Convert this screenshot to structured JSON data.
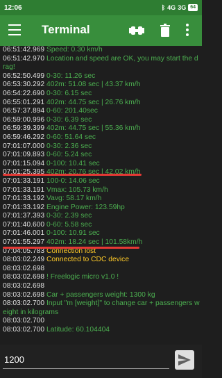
{
  "status": {
    "time": "12:06",
    "signal1": "4G",
    "signal2": "3G",
    "battery": "64"
  },
  "appbar": {
    "title": "Terminal"
  },
  "icons": {
    "menu": "menu-icon",
    "connect": "plug-connect-icon",
    "delete": "trash-icon",
    "more": "more-vert-icon",
    "send": "send-icon"
  },
  "colors": {
    "accent": "#388e3c",
    "status_bar": "#2e7d32",
    "terminal_bg": "#1e1e1e",
    "text_green": "#4caf50",
    "text_yellow": "#ffca28",
    "annotation": "#e53935"
  },
  "log": [
    {
      "ts": "06:51:42.969",
      "msg": "Speed: 0.30   km/h",
      "c": "g"
    },
    {
      "ts": "06:51:42.970",
      "msg": "Location and speed are OK, you may start the drag!",
      "c": "g"
    },
    {
      "ts": "06:52:50.499",
      "msg": "0-30: 11.26 sec",
      "c": "g"
    },
    {
      "ts": "06:53:30.292",
      "msg": "402m: 51.08 sec | 43.37 km/h",
      "c": "g"
    },
    {
      "ts": "06:54:22.690",
      "msg": "0-30: 6.15  sec",
      "c": "g"
    },
    {
      "ts": "06:55:01.291",
      "msg": "402m: 44.75 sec | 26.76 km/h",
      "c": "g"
    },
    {
      "ts": "06:57:37.894",
      "msg": "0-60: 201.40sec",
      "c": "g"
    },
    {
      "ts": "06:59:00.996",
      "msg": "0-30: 6.39  sec",
      "c": "g"
    },
    {
      "ts": "06:59:39.399",
      "msg": "402m: 44.75 sec | 55.36 km/h",
      "c": "g"
    },
    {
      "ts": "06:59:46.292",
      "msg": "0-60: 51.64 sec",
      "c": "g"
    },
    {
      "ts": "07:01:07.000",
      "msg": "0-30: 2.36  sec",
      "c": "g"
    },
    {
      "ts": "07:01:09.893",
      "msg": "0-60: 5.24  sec",
      "c": "g"
    },
    {
      "ts": "07:01:15.094",
      "msg": "0-100: 10.41 sec",
      "c": "g"
    },
    {
      "ts": "07:01:25.395",
      "msg": "402m: 20.76 sec | 42.02 km/h",
      "c": "g"
    },
    {
      "ts": "07:01:33.191",
      "msg": "100-0: 14.06 sec",
      "c": "g"
    },
    {
      "ts": "07:01:33.191",
      "msg": "Vmax: 105.73 km/h",
      "c": "g"
    },
    {
      "ts": "07:01:33.192",
      "msg": "Vavg: 58.17  km/h",
      "c": "g"
    },
    {
      "ts": "07:01:33.192",
      "msg": "Engine Power: 123.59hp",
      "c": "g"
    },
    {
      "ts": "07:01:37.393",
      "msg": "0-30: 2.39  sec",
      "c": "g"
    },
    {
      "ts": "07:01:40.600",
      "msg": "0-60: 5.58  sec",
      "c": "g"
    },
    {
      "ts": "07:01:46.001",
      "msg": "0-100: 10.91 sec",
      "c": "g"
    },
    {
      "ts": "07:01:55.297",
      "msg": "402m: 18.24 sec | 101.58km/h",
      "c": "g"
    },
    {
      "ts": "07:04:05.783",
      "msg": "Connection lost",
      "c": "y"
    },
    {
      "ts": "08:03:02.249",
      "msg": "Connected to CDC device",
      "c": "y"
    },
    {
      "ts": "08:03:02.698",
      "msg": "",
      "c": "w"
    },
    {
      "ts": "08:03:02.698",
      "msg": "! Freelogic micro v1.0 !",
      "c": "g"
    },
    {
      "ts": "08:03:02.698",
      "msg": "",
      "c": "w"
    },
    {
      "ts": "08:03:02.698",
      "msg": "Car + passengers weight: 1300 kg",
      "c": "g"
    },
    {
      "ts": "08:03:02.700",
      "msg": "Input \"m [weight]\" to change car + passengers weight in kilograms",
      "c": "g"
    },
    {
      "ts": "08:03:02.700",
      "msg": "",
      "c": "w"
    },
    {
      "ts": "08:03:02.700",
      "msg": "Latitude: 60.104404",
      "c": "g"
    }
  ],
  "input": {
    "value": "1200"
  }
}
